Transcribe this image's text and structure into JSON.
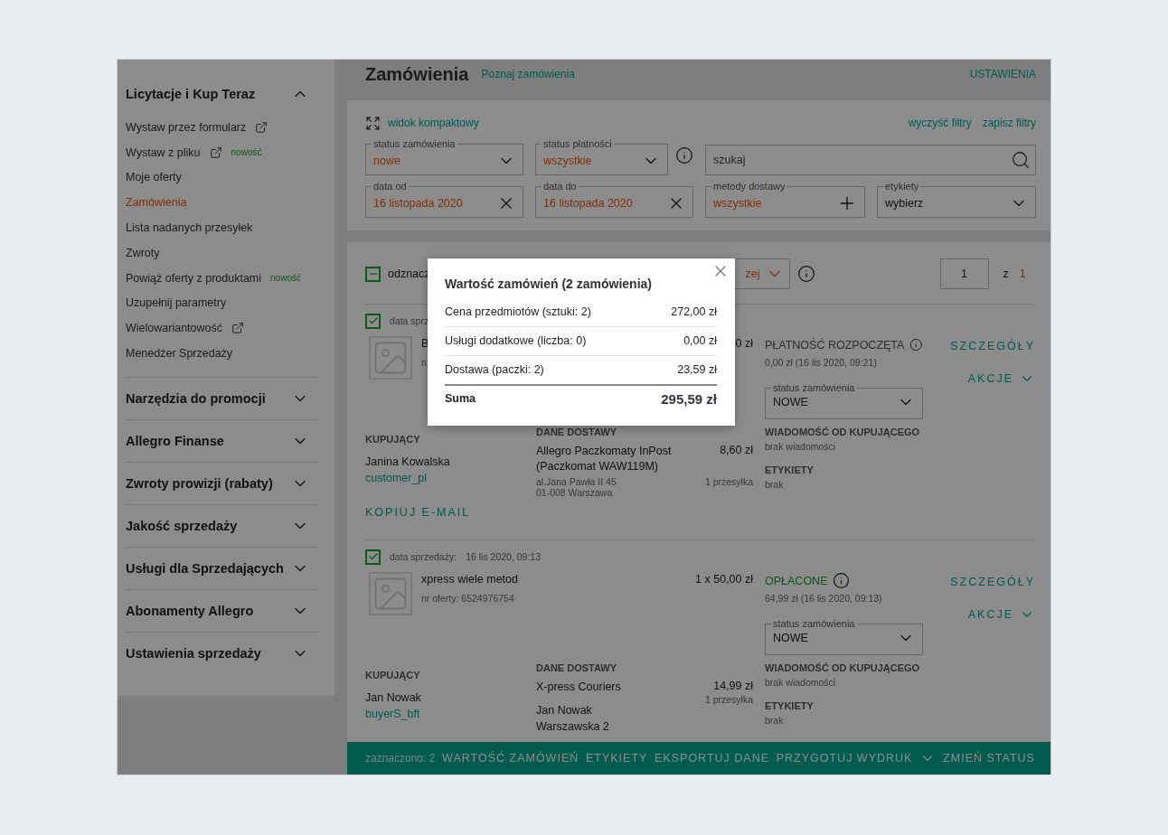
{
  "sidebar": {
    "sections": [
      {
        "title": "Licytacje i Kup Teraz",
        "expanded": true,
        "items": [
          {
            "label": "Wystaw przez formularz",
            "external": true,
            "selected": false
          },
          {
            "label": "Wystaw z pliku",
            "external": true,
            "badge": "nowość",
            "selected": false
          },
          {
            "label": "Moje oferty",
            "external": false,
            "selected": false
          },
          {
            "label": "Zamówienia",
            "external": false,
            "selected": true
          },
          {
            "label": "Lista nadanych przesyłek",
            "external": false,
            "selected": false
          },
          {
            "label": "Zwroty",
            "external": false,
            "selected": false
          },
          {
            "label": "Powiąż oferty z produktami",
            "external": false,
            "badge": "nowość",
            "selected": false
          },
          {
            "label": "Uzupełnij parametry",
            "external": false,
            "selected": false
          },
          {
            "label": "Wielowariantowość",
            "external": true,
            "selected": false
          },
          {
            "label": "Menedżer Sprzedaży",
            "external": false,
            "selected": false
          }
        ]
      },
      {
        "title": "Narzędzia do promocji",
        "expanded": false
      },
      {
        "title": "Allegro Finanse",
        "expanded": false
      },
      {
        "title": "Zwroty prowizji (rabaty)",
        "expanded": false
      },
      {
        "title": "Jakość sprzedaży",
        "expanded": false
      },
      {
        "title": "Usługi dla Sprzedających",
        "expanded": false
      },
      {
        "title": "Abonamenty Allegro",
        "expanded": false
      },
      {
        "title": "Ustawienia sprzedaży",
        "expanded": false
      }
    ]
  },
  "header": {
    "title": "Zamówienia",
    "link": "Poznaj zamówienia",
    "settings": "USTAWIENIA"
  },
  "filters": {
    "compact_view": "widok kompaktowy",
    "clear": "wyczyść filtry",
    "save": "zapisz filtry",
    "fields": [
      {
        "kind": "select",
        "label": "status zamówienia",
        "value": "nowe",
        "active": true,
        "info": false
      },
      {
        "kind": "select",
        "label": "status płatności",
        "value": "wszystkie",
        "active": true,
        "info": true
      },
      {
        "kind": "search",
        "placeholder": "szukaj"
      },
      {
        "kind": "date",
        "label": "data od",
        "value": "16 listopada 2020",
        "active": true
      },
      {
        "kind": "date",
        "label": "data do",
        "value": "16 listopada 2020",
        "active": true
      },
      {
        "kind": "add",
        "label": "metody dostawy",
        "value": "wszystkie",
        "active": true
      },
      {
        "kind": "select",
        "label": "etykiety",
        "value": "wybierz",
        "active": false
      }
    ]
  },
  "toolbar": {
    "select_all": {
      "label": "odznacz",
      "indeterminate": true
    },
    "sort_value": "zej",
    "page": "1",
    "of": "z",
    "pages": "1"
  },
  "orders": [
    {
      "checked": true,
      "sale_date_label": "data sprz",
      "title": "B",
      "offer": "n",
      "price": "0 zł",
      "payment": {
        "status": "PŁATNOŚĆ ROZPOCZĘTA",
        "paid": false,
        "detail": "0,00 zł  (16 lis 2020, 09:21)"
      },
      "status_select": {
        "label": "status zamówienia",
        "value": "NOWE"
      },
      "details": "SZCZEGÓŁY",
      "actions": "AKCJE",
      "buyer": {
        "heading": "KUPUJĄCY",
        "name": "Janina Kowalska",
        "login": "customer_pl",
        "copy_email": "KOPIUJ E-MAIL"
      },
      "delivery": {
        "heading": "DANE DOSTAWY",
        "method": "Allegro Paczkomaty InPost (Paczkomat WAW119M)",
        "price": "8,60 zł",
        "parcels": "1 przesyłka",
        "address_muted": true,
        "address": [
          "al.Jana Pawła II 45",
          "01-008 Warszawa"
        ]
      },
      "message": {
        "heading": "WIADOMOŚĆ OD KUPUJĄCEGO",
        "text": "brak wiadomości"
      },
      "labels": {
        "heading": "ETYKIETY",
        "text": "brak"
      }
    },
    {
      "checked": true,
      "sale_date_label": "data sprzedaży:",
      "sale_date": "16 lis 2020, 09:13",
      "title": "xpress wiele metod",
      "offer": "nr oferty: 6524976754",
      "price": "1 x 50,00 zł",
      "payment": {
        "status": "OPŁACONE",
        "paid": true,
        "detail": "64,99 zł  (16 lis 2020, 09:13)"
      },
      "status_select": {
        "label": "status zamówienia",
        "value": "NOWE"
      },
      "details": "SZCZEGÓŁY",
      "actions": "AKCJE",
      "buyer": {
        "heading": "KUPUJĄCY",
        "name": "Jan Nowak",
        "login": "buyerS_bft"
      },
      "delivery": {
        "heading": "DANE DOSTAWY",
        "method": "X-press Couriers",
        "price": "14,99 zł",
        "parcels": "1 przesyłka",
        "address_muted": false,
        "address": [
          "Jan Nowak",
          "Warszawska 2"
        ]
      },
      "message": {
        "heading": "WIADOMOŚĆ OD KUPUJĄCEGO",
        "text": "brak wiadomości"
      },
      "labels": {
        "heading": "ETYKIETY",
        "text": "brak"
      }
    }
  ],
  "bottom_bar": {
    "selected_count": "zaznaczono: 2",
    "actions": [
      {
        "label": "WARTOŚĆ ZAMÓWIEŃ",
        "dropdown": false
      },
      {
        "label": "ETYKIETY",
        "dropdown": false
      },
      {
        "label": "EKSPORTUJ DANE",
        "dropdown": false
      },
      {
        "label": "PRZYGOTUJ WYDRUK",
        "dropdown": true
      },
      {
        "label": "ZMIEŃ STATUS",
        "dropdown": false
      }
    ]
  },
  "modal": {
    "title": "Wartość zamówień (2 zamówienia)",
    "rows": [
      {
        "label": "Cena przedmiotów (sztuki: 2)",
        "value": "272,00 zł"
      },
      {
        "label": "Usługi dodatkowe (liczba: 0)",
        "value": "0,00 zł"
      },
      {
        "label": "Dostawa (paczki: 2)",
        "value": "23,59 zł"
      }
    ],
    "total": {
      "label": "Suma",
      "value": "295,59 zł"
    }
  }
}
